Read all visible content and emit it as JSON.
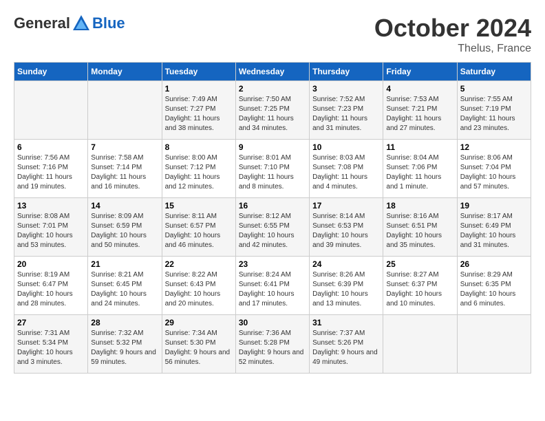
{
  "header": {
    "logo": {
      "general": "General",
      "blue": "Blue"
    },
    "title": "October 2024",
    "location": "Thelus, France"
  },
  "days_of_week": [
    "Sunday",
    "Monday",
    "Tuesday",
    "Wednesday",
    "Thursday",
    "Friday",
    "Saturday"
  ],
  "weeks": [
    [
      {
        "day": "",
        "sunrise": "",
        "sunset": "",
        "daylight": ""
      },
      {
        "day": "",
        "sunrise": "",
        "sunset": "",
        "daylight": ""
      },
      {
        "day": "1",
        "sunrise": "Sunrise: 7:49 AM",
        "sunset": "Sunset: 7:27 PM",
        "daylight": "Daylight: 11 hours and 38 minutes."
      },
      {
        "day": "2",
        "sunrise": "Sunrise: 7:50 AM",
        "sunset": "Sunset: 7:25 PM",
        "daylight": "Daylight: 11 hours and 34 minutes."
      },
      {
        "day": "3",
        "sunrise": "Sunrise: 7:52 AM",
        "sunset": "Sunset: 7:23 PM",
        "daylight": "Daylight: 11 hours and 31 minutes."
      },
      {
        "day": "4",
        "sunrise": "Sunrise: 7:53 AM",
        "sunset": "Sunset: 7:21 PM",
        "daylight": "Daylight: 11 hours and 27 minutes."
      },
      {
        "day": "5",
        "sunrise": "Sunrise: 7:55 AM",
        "sunset": "Sunset: 7:19 PM",
        "daylight": "Daylight: 11 hours and 23 minutes."
      }
    ],
    [
      {
        "day": "6",
        "sunrise": "Sunrise: 7:56 AM",
        "sunset": "Sunset: 7:16 PM",
        "daylight": "Daylight: 11 hours and 19 minutes."
      },
      {
        "day": "7",
        "sunrise": "Sunrise: 7:58 AM",
        "sunset": "Sunset: 7:14 PM",
        "daylight": "Daylight: 11 hours and 16 minutes."
      },
      {
        "day": "8",
        "sunrise": "Sunrise: 8:00 AM",
        "sunset": "Sunset: 7:12 PM",
        "daylight": "Daylight: 11 hours and 12 minutes."
      },
      {
        "day": "9",
        "sunrise": "Sunrise: 8:01 AM",
        "sunset": "Sunset: 7:10 PM",
        "daylight": "Daylight: 11 hours and 8 minutes."
      },
      {
        "day": "10",
        "sunrise": "Sunrise: 8:03 AM",
        "sunset": "Sunset: 7:08 PM",
        "daylight": "Daylight: 11 hours and 4 minutes."
      },
      {
        "day": "11",
        "sunrise": "Sunrise: 8:04 AM",
        "sunset": "Sunset: 7:06 PM",
        "daylight": "Daylight: 11 hours and 1 minute."
      },
      {
        "day": "12",
        "sunrise": "Sunrise: 8:06 AM",
        "sunset": "Sunset: 7:04 PM",
        "daylight": "Daylight: 10 hours and 57 minutes."
      }
    ],
    [
      {
        "day": "13",
        "sunrise": "Sunrise: 8:08 AM",
        "sunset": "Sunset: 7:01 PM",
        "daylight": "Daylight: 10 hours and 53 minutes."
      },
      {
        "day": "14",
        "sunrise": "Sunrise: 8:09 AM",
        "sunset": "Sunset: 6:59 PM",
        "daylight": "Daylight: 10 hours and 50 minutes."
      },
      {
        "day": "15",
        "sunrise": "Sunrise: 8:11 AM",
        "sunset": "Sunset: 6:57 PM",
        "daylight": "Daylight: 10 hours and 46 minutes."
      },
      {
        "day": "16",
        "sunrise": "Sunrise: 8:12 AM",
        "sunset": "Sunset: 6:55 PM",
        "daylight": "Daylight: 10 hours and 42 minutes."
      },
      {
        "day": "17",
        "sunrise": "Sunrise: 8:14 AM",
        "sunset": "Sunset: 6:53 PM",
        "daylight": "Daylight: 10 hours and 39 minutes."
      },
      {
        "day": "18",
        "sunrise": "Sunrise: 8:16 AM",
        "sunset": "Sunset: 6:51 PM",
        "daylight": "Daylight: 10 hours and 35 minutes."
      },
      {
        "day": "19",
        "sunrise": "Sunrise: 8:17 AM",
        "sunset": "Sunset: 6:49 PM",
        "daylight": "Daylight: 10 hours and 31 minutes."
      }
    ],
    [
      {
        "day": "20",
        "sunrise": "Sunrise: 8:19 AM",
        "sunset": "Sunset: 6:47 PM",
        "daylight": "Daylight: 10 hours and 28 minutes."
      },
      {
        "day": "21",
        "sunrise": "Sunrise: 8:21 AM",
        "sunset": "Sunset: 6:45 PM",
        "daylight": "Daylight: 10 hours and 24 minutes."
      },
      {
        "day": "22",
        "sunrise": "Sunrise: 8:22 AM",
        "sunset": "Sunset: 6:43 PM",
        "daylight": "Daylight: 10 hours and 20 minutes."
      },
      {
        "day": "23",
        "sunrise": "Sunrise: 8:24 AM",
        "sunset": "Sunset: 6:41 PM",
        "daylight": "Daylight: 10 hours and 17 minutes."
      },
      {
        "day": "24",
        "sunrise": "Sunrise: 8:26 AM",
        "sunset": "Sunset: 6:39 PM",
        "daylight": "Daylight: 10 hours and 13 minutes."
      },
      {
        "day": "25",
        "sunrise": "Sunrise: 8:27 AM",
        "sunset": "Sunset: 6:37 PM",
        "daylight": "Daylight: 10 hours and 10 minutes."
      },
      {
        "day": "26",
        "sunrise": "Sunrise: 8:29 AM",
        "sunset": "Sunset: 6:35 PM",
        "daylight": "Daylight: 10 hours and 6 minutes."
      }
    ],
    [
      {
        "day": "27",
        "sunrise": "Sunrise: 7:31 AM",
        "sunset": "Sunset: 5:34 PM",
        "daylight": "Daylight: 10 hours and 3 minutes."
      },
      {
        "day": "28",
        "sunrise": "Sunrise: 7:32 AM",
        "sunset": "Sunset: 5:32 PM",
        "daylight": "Daylight: 9 hours and 59 minutes."
      },
      {
        "day": "29",
        "sunrise": "Sunrise: 7:34 AM",
        "sunset": "Sunset: 5:30 PM",
        "daylight": "Daylight: 9 hours and 56 minutes."
      },
      {
        "day": "30",
        "sunrise": "Sunrise: 7:36 AM",
        "sunset": "Sunset: 5:28 PM",
        "daylight": "Daylight: 9 hours and 52 minutes."
      },
      {
        "day": "31",
        "sunrise": "Sunrise: 7:37 AM",
        "sunset": "Sunset: 5:26 PM",
        "daylight": "Daylight: 9 hours and 49 minutes."
      },
      {
        "day": "",
        "sunrise": "",
        "sunset": "",
        "daylight": ""
      },
      {
        "day": "",
        "sunrise": "",
        "sunset": "",
        "daylight": ""
      }
    ]
  ]
}
